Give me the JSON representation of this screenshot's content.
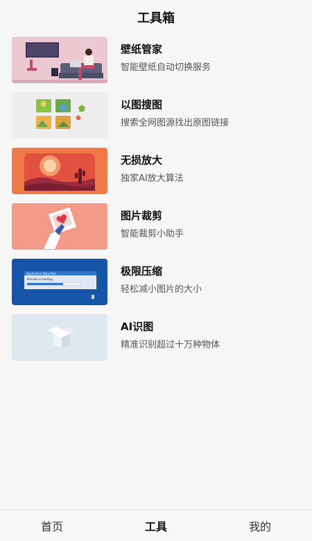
{
  "header": {
    "title": "工具箱"
  },
  "tools": [
    {
      "name": "壁纸管家",
      "desc": "智能壁纸自动切换服务",
      "icon": "wallpaper-illustration"
    },
    {
      "name": "以图搜图",
      "desc": "搜索全网图源找出原图链接",
      "icon": "puzzle-illustration"
    },
    {
      "name": "无损放大",
      "desc": "独家AI放大算法",
      "icon": "desert-sunset-illustration"
    },
    {
      "name": "图片裁剪",
      "desc": "智能裁剪小助手",
      "icon": "photo-hand-illustration"
    },
    {
      "name": "极限压缩",
      "desc": "轻松减小图片的大小",
      "icon": "compress-dialog-illustration",
      "thumb_text": {
        "window_title": "Application Detection",
        "status": "Preview is loading..."
      }
    },
    {
      "name": "AI识图",
      "desc": "精准识别超过十万种物体",
      "icon": "open-box-illustration"
    }
  ],
  "tabbar": {
    "items": [
      {
        "label": "首页",
        "active": false
      },
      {
        "label": "工具",
        "active": true
      },
      {
        "label": "我的",
        "active": false
      }
    ]
  }
}
